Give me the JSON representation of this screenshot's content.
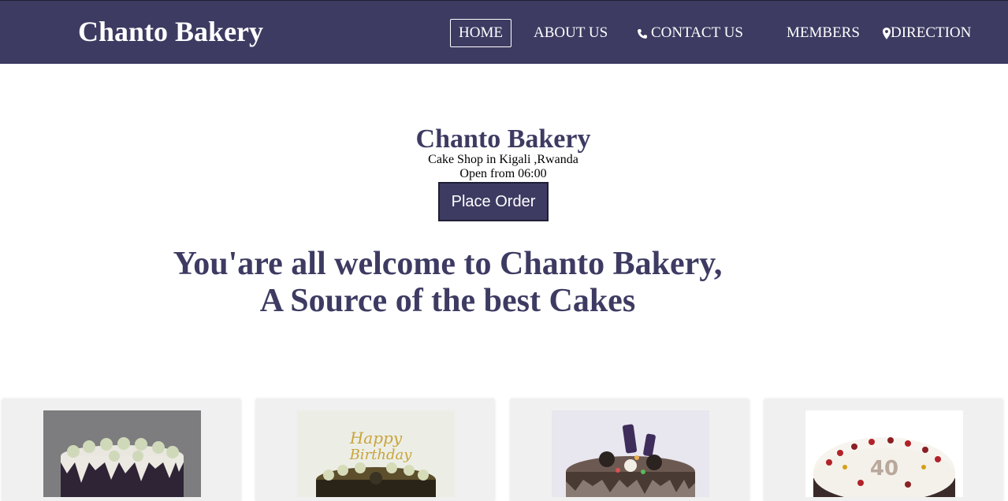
{
  "navbar": {
    "brand": "Chanto Bakery",
    "items": [
      {
        "label": "HOME",
        "icon": "",
        "active": true
      },
      {
        "label": "ABOUT US",
        "icon": ""
      },
      {
        "label": "CONTACT US",
        "icon": "phone-icon"
      },
      {
        "label": "MEMBERS",
        "icon": ""
      },
      {
        "label": "DIRECTION",
        "icon": "map-marker-icon"
      }
    ]
  },
  "hero": {
    "title": "Chanto Bakery",
    "subtitle": "Cake Shop in Kigali ,Rwanda",
    "hours": "Open from 06:00",
    "order_button": "Place Order"
  },
  "welcome": {
    "line1": "You'are all welcome to Chanto Bakery,",
    "line2": "A Source of the best Cakes"
  },
  "colors": {
    "primary": "#3d3b62",
    "card_bg": "#f0f0f0"
  },
  "cards": [
    {
      "image": "cake-white-green-drip"
    },
    {
      "image": "cake-happy-birthday-topper"
    },
    {
      "image": "cake-chocolate-oreo-drip"
    },
    {
      "image": "cake-40-red-berries"
    }
  ]
}
